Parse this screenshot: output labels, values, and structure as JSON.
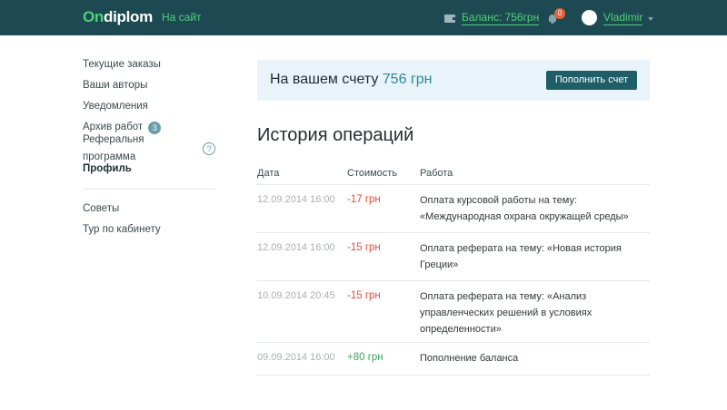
{
  "header": {
    "logo_on": "On",
    "logo_rest": "diplom",
    "site_link": "На сайт",
    "balance_label": "Баланс: 756грн",
    "notifications_count": "0",
    "username": "Vladimir"
  },
  "sidebar": {
    "items": [
      {
        "label": "Текущие заказы"
      },
      {
        "label": "Ваши авторы"
      },
      {
        "label": "Уведомления"
      },
      {
        "label": "Архив работ",
        "badge": "3"
      },
      {
        "label": "Реферальня программа",
        "help": "?"
      },
      {
        "label": "Профиль"
      }
    ],
    "secondary": [
      {
        "label": "Советы"
      },
      {
        "label": "Тур по кабинету"
      }
    ]
  },
  "banner": {
    "text": "На вашем счету",
    "amount": "756 грн",
    "button": "Пополнить счет"
  },
  "history": {
    "title": "История операций",
    "headers": {
      "date": "Дата",
      "cost": "Стоимость",
      "work": "Работа"
    },
    "rows": [
      {
        "date": "12.09.2014 16:00",
        "cost": "-17 грн",
        "work": "Оплата курсовой работы на тему: «Международная охрана окружащей среды»"
      },
      {
        "date": "12.09.2014 16:00",
        "cost": "-15 грн",
        "work": "Оплата реферата на тему: «Новая история Греции»"
      },
      {
        "date": "10.09.2014 20:45",
        "cost": "-15 грн",
        "work": "Оплата реферата на тему: «Анализ управленческих решений в условиях определенности»"
      },
      {
        "date": "09.09.2014 16:00",
        "cost": "+80 грн",
        "work": "Пополнение баланса"
      }
    ]
  },
  "colors": {
    "header_bg": "#1d4a52",
    "accent_green": "#4fd17a",
    "negative": "#e44c3c",
    "positive": "#3ba55d",
    "button_bg": "#1f5e67"
  }
}
